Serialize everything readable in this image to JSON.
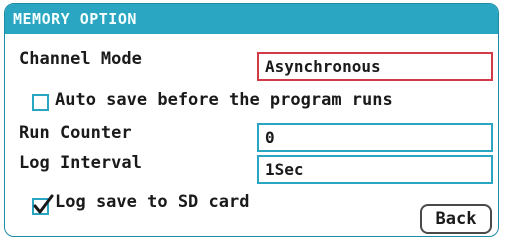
{
  "title": "MEMORY OPTION",
  "channel_mode": {
    "label": "Channel Mode",
    "value": "Asynchronous"
  },
  "auto_save": {
    "label": "Auto save before the program runs",
    "checked": false
  },
  "run_counter": {
    "label": "Run Counter",
    "value": "0"
  },
  "log_interval": {
    "label": "Log Interval",
    "value": "1Sec"
  },
  "log_sd": {
    "label": "Log save to SD card",
    "checked": true
  },
  "back_label": "Back",
  "colors": {
    "accent": "#2aa6c2",
    "focus": "#d23a46"
  }
}
